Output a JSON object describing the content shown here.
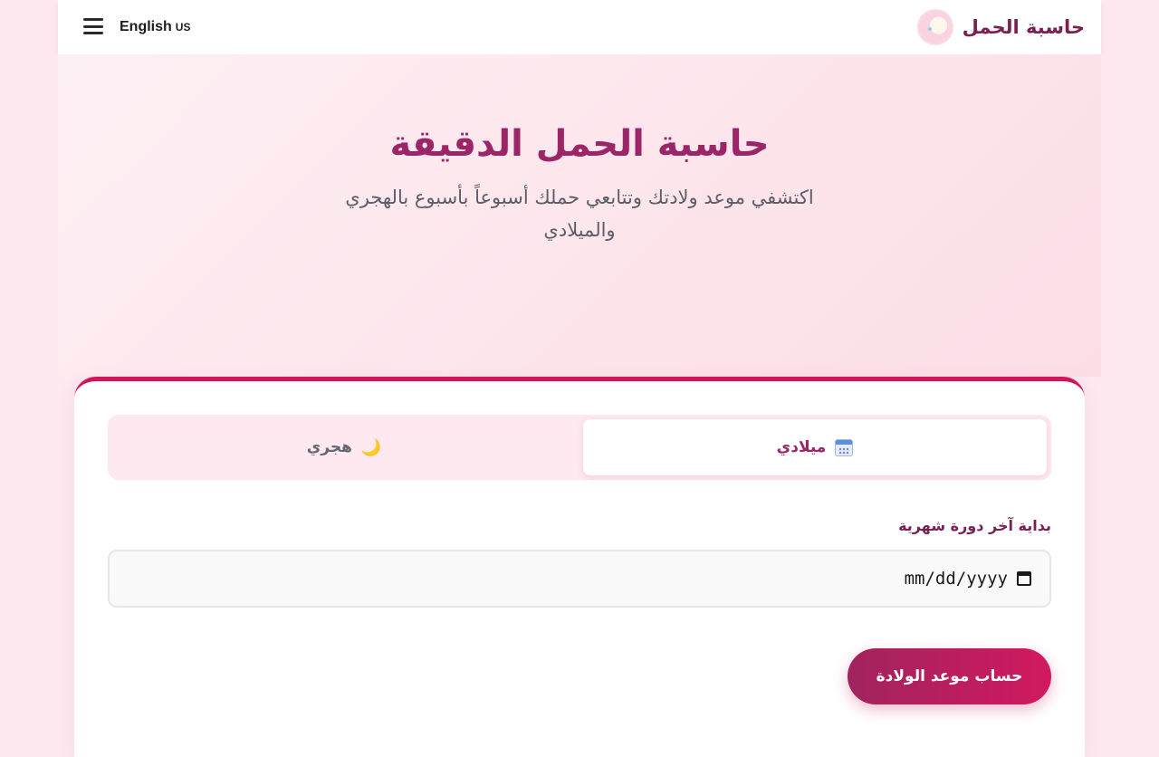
{
  "header": {
    "brand_name": "حاسبة الحمل",
    "language_label": "English",
    "language_flag": "US"
  },
  "hero": {
    "title": "حاسبة الحمل الدقيقة",
    "subtitle": "اكتشفي موعد ولادتك وتتابعي حملك أسبوعاً بأسبوع بالهجري والميلادي"
  },
  "calculator": {
    "tabs": [
      {
        "label": "ميلادي",
        "icon": "calendar-icon",
        "active": true
      },
      {
        "label": "هجري",
        "icon": "crescent-moon-icon",
        "active": false
      }
    ],
    "field_label": "بداية آخر دورة شهرية",
    "date_placeholder": "mm/dd/yyyy",
    "submit_label": "حساب موعد الولادة"
  },
  "colors": {
    "accent": "#d1155d",
    "brand_text": "#9b2567",
    "page_bg": "#fde9ef"
  }
}
